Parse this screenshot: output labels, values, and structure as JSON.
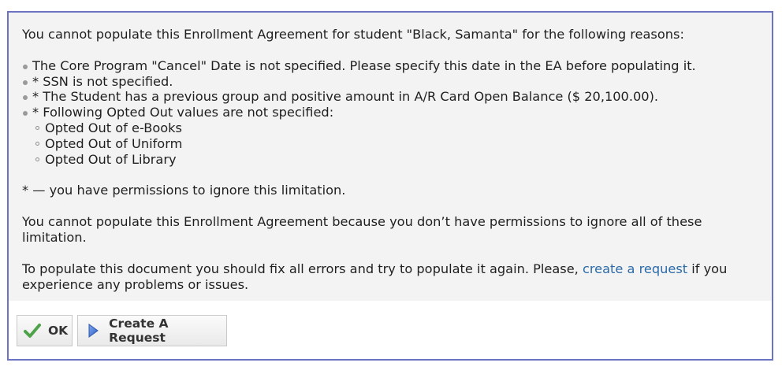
{
  "dialog": {
    "intro": "You cannot populate this Enrollment Agreement for student \"Black, Samanta\" for the following reasons:",
    "reasons": [
      "The Core Program \"Cancel\" Date is not specified. Please specify this date in the EA before populating it.",
      "* SSN is not specified.",
      "* The Student has a previous group and positive amount in A/R Card Open Balance ($ 20,100.00).",
      "* Following Opted Out values are not specified:"
    ],
    "opted_out": [
      "Opted Out of e-Books",
      "Opted Out of Uniform",
      "Opted Out of Library"
    ],
    "footnote": "* — you have permissions to ignore this limitation.",
    "no_permission": "You cannot populate this Enrollment Agreement because you don’t have permissions to ignore all of these limitation.",
    "fix_prefix": "To populate this document you should fix all errors and try to populate it again. Please, ",
    "fix_link": "create a request",
    "fix_suffix": " if you experience any problems or issues."
  },
  "buttons": {
    "ok_label": "OK",
    "ok_icon": "checkmark-icon",
    "request_label": "Create A Request",
    "request_icon": "play-arrow-icon"
  },
  "colors": {
    "border": "#6a74c2",
    "content_bg": "#f3f3f3",
    "link": "#2a6aa8",
    "check": "#4ea34a",
    "arrow": "#3b6fd0"
  }
}
